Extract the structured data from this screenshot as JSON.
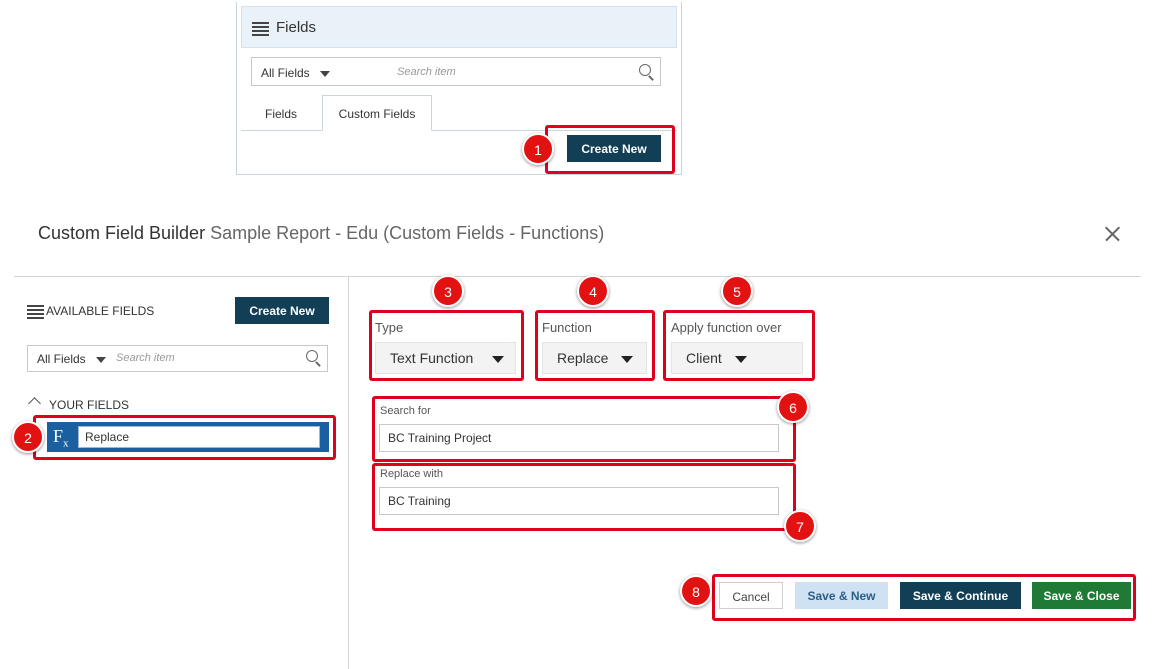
{
  "fields_panel": {
    "title": "Fields",
    "filter_dropdown": "All Fields",
    "search_placeholder": "Search item",
    "tabs": [
      {
        "label": "Fields",
        "active": false
      },
      {
        "label": "Custom Fields",
        "active": true
      }
    ],
    "create_new_label": "Create New"
  },
  "dialog": {
    "title": "Custom Field Builder",
    "subtitle": "Sample Report - Edu (Custom Fields - Functions)",
    "close_icon": "close-icon"
  },
  "left_pane": {
    "available_fields_label": "AVAILABLE FIELDS",
    "create_new_label": "Create New",
    "filter_dropdown": "All Fields",
    "search_placeholder": "Search item",
    "your_fields_label": "YOUR FIELDS",
    "field_item": {
      "icon": "fx-icon",
      "icon_main": "F",
      "icon_sub": "x",
      "name": "Replace"
    }
  },
  "right_pane": {
    "type": {
      "label": "Type",
      "value": "Text Function"
    },
    "function": {
      "label": "Function",
      "value": "Replace"
    },
    "apply_over": {
      "label": "Apply function over",
      "value": "Client"
    },
    "search_for": {
      "label": "Search for",
      "value": "BC Training Project"
    },
    "replace_with": {
      "label": "Replace with",
      "value": "BC Training"
    }
  },
  "actions": {
    "cancel": "Cancel",
    "save_new": "Save & New",
    "save_continue": "Save & Continue",
    "save_close": "Save & Close"
  },
  "annotations": [
    "1",
    "2",
    "3",
    "4",
    "5",
    "6",
    "7",
    "8"
  ],
  "colors": {
    "highlight": "#e0001b",
    "badge": "#e31212",
    "primary_dark": "#123f55",
    "selected_blue": "#1a5fa0",
    "save_close_green": "#1e7a35",
    "save_new_light": "#cfe2f3"
  }
}
